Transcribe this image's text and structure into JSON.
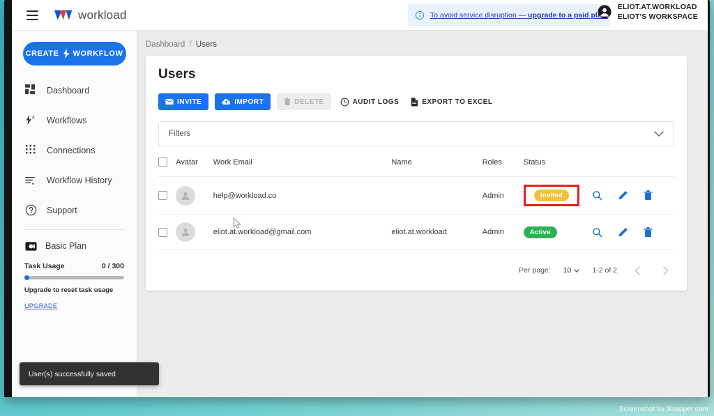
{
  "topbar": {
    "menu_icon": "hamburger-icon",
    "logo_icon": "workload-w-logo",
    "brand": "workload",
    "banner": {
      "icon": "info-circle-icon",
      "text_plain": "To avoid service disruption — ",
      "text_bold": "upgrade to a paid plan."
    },
    "account": {
      "icon": "account-circle-icon",
      "name": "ELIOT.AT.WORKLOAD",
      "workspace": "ELIOT'S WORKSPACE"
    }
  },
  "sidebar": {
    "create_button": {
      "label_left": "CREATE",
      "label_right": "WORKFLOW",
      "icon": "lightning-bolt-icon"
    },
    "items": [
      {
        "label": "Dashboard",
        "icon": "dashboard-grid-icon"
      },
      {
        "label": "Workflows",
        "icon": "workflow-bolt-icon"
      },
      {
        "label": "Connections",
        "icon": "apps-dots-icon"
      },
      {
        "label": "Workflow History",
        "icon": "history-list-icon"
      },
      {
        "label": "Support",
        "icon": "help-circle-icon"
      }
    ],
    "plan": {
      "icon": "plan-card-icon",
      "name": "Basic Plan",
      "usage_label": "Task Usage",
      "usage_value": "0 / 300",
      "usage_percent": 0,
      "hint": "Upgrade to reset task usage",
      "upgrade_link": "UPGRADE"
    }
  },
  "main": {
    "breadcrumb": {
      "root": "Dashboard",
      "separator": "/",
      "current": "Users"
    },
    "page_title": "Users",
    "toolbar": [
      {
        "label": "INVITE",
        "icon": "envelope-icon",
        "style": "primary",
        "disabled": false
      },
      {
        "label": "IMPORT",
        "icon": "cloud-upload-icon",
        "style": "primary",
        "disabled": false
      },
      {
        "label": "DELETE",
        "icon": "trash-icon",
        "style": "disabled",
        "disabled": true
      },
      {
        "label": "AUDIT LOGS",
        "icon": "history-clock-icon",
        "style": "ghost",
        "disabled": false
      },
      {
        "label": "EXPORT TO EXCEL",
        "icon": "document-icon",
        "style": "ghost",
        "disabled": false
      }
    ],
    "filters": {
      "label": "Filters",
      "chevron_icon": "chevron-down-icon",
      "expanded": false
    },
    "table": {
      "columns": [
        "",
        "Avatar",
        "Work Email",
        "Name",
        "Roles",
        "Status",
        ""
      ],
      "rows": [
        {
          "selected": false,
          "avatar_icon": "person-avatar-icon",
          "email": "help@workload.co",
          "name": "",
          "role": "Admin",
          "status": "Invited",
          "status_color": "#f2c13d",
          "highlighted": true,
          "actions": [
            "search-icon",
            "edit-pencil-icon",
            "trash-icon"
          ]
        },
        {
          "selected": false,
          "avatar_icon": "person-avatar-icon",
          "email": "eliot.at.workload@gmail.com",
          "name": "eliot.at.workload",
          "role": "Admin",
          "status": "Active",
          "status_color": "#2eb154",
          "highlighted": false,
          "actions": [
            "search-icon",
            "edit-pencil-icon",
            "trash-icon"
          ]
        }
      ]
    },
    "pagination": {
      "per_page_label": "Per page:",
      "per_page_value": "10",
      "range": "1-2 of 2",
      "prev_icon": "chevron-left-icon",
      "next_icon": "chevron-right-icon"
    }
  },
  "toast": {
    "message": "User(s) successfully saved"
  },
  "watermark": "Screenshot by Xnapper.com",
  "colors": {
    "accent_blue": "#1a73e8",
    "status_invited": "#f2c13d",
    "status_active": "#2eb154",
    "highlight_red": "#ee1b1b",
    "banner_bg": "#e8f2fd",
    "toast_bg": "#323232"
  }
}
